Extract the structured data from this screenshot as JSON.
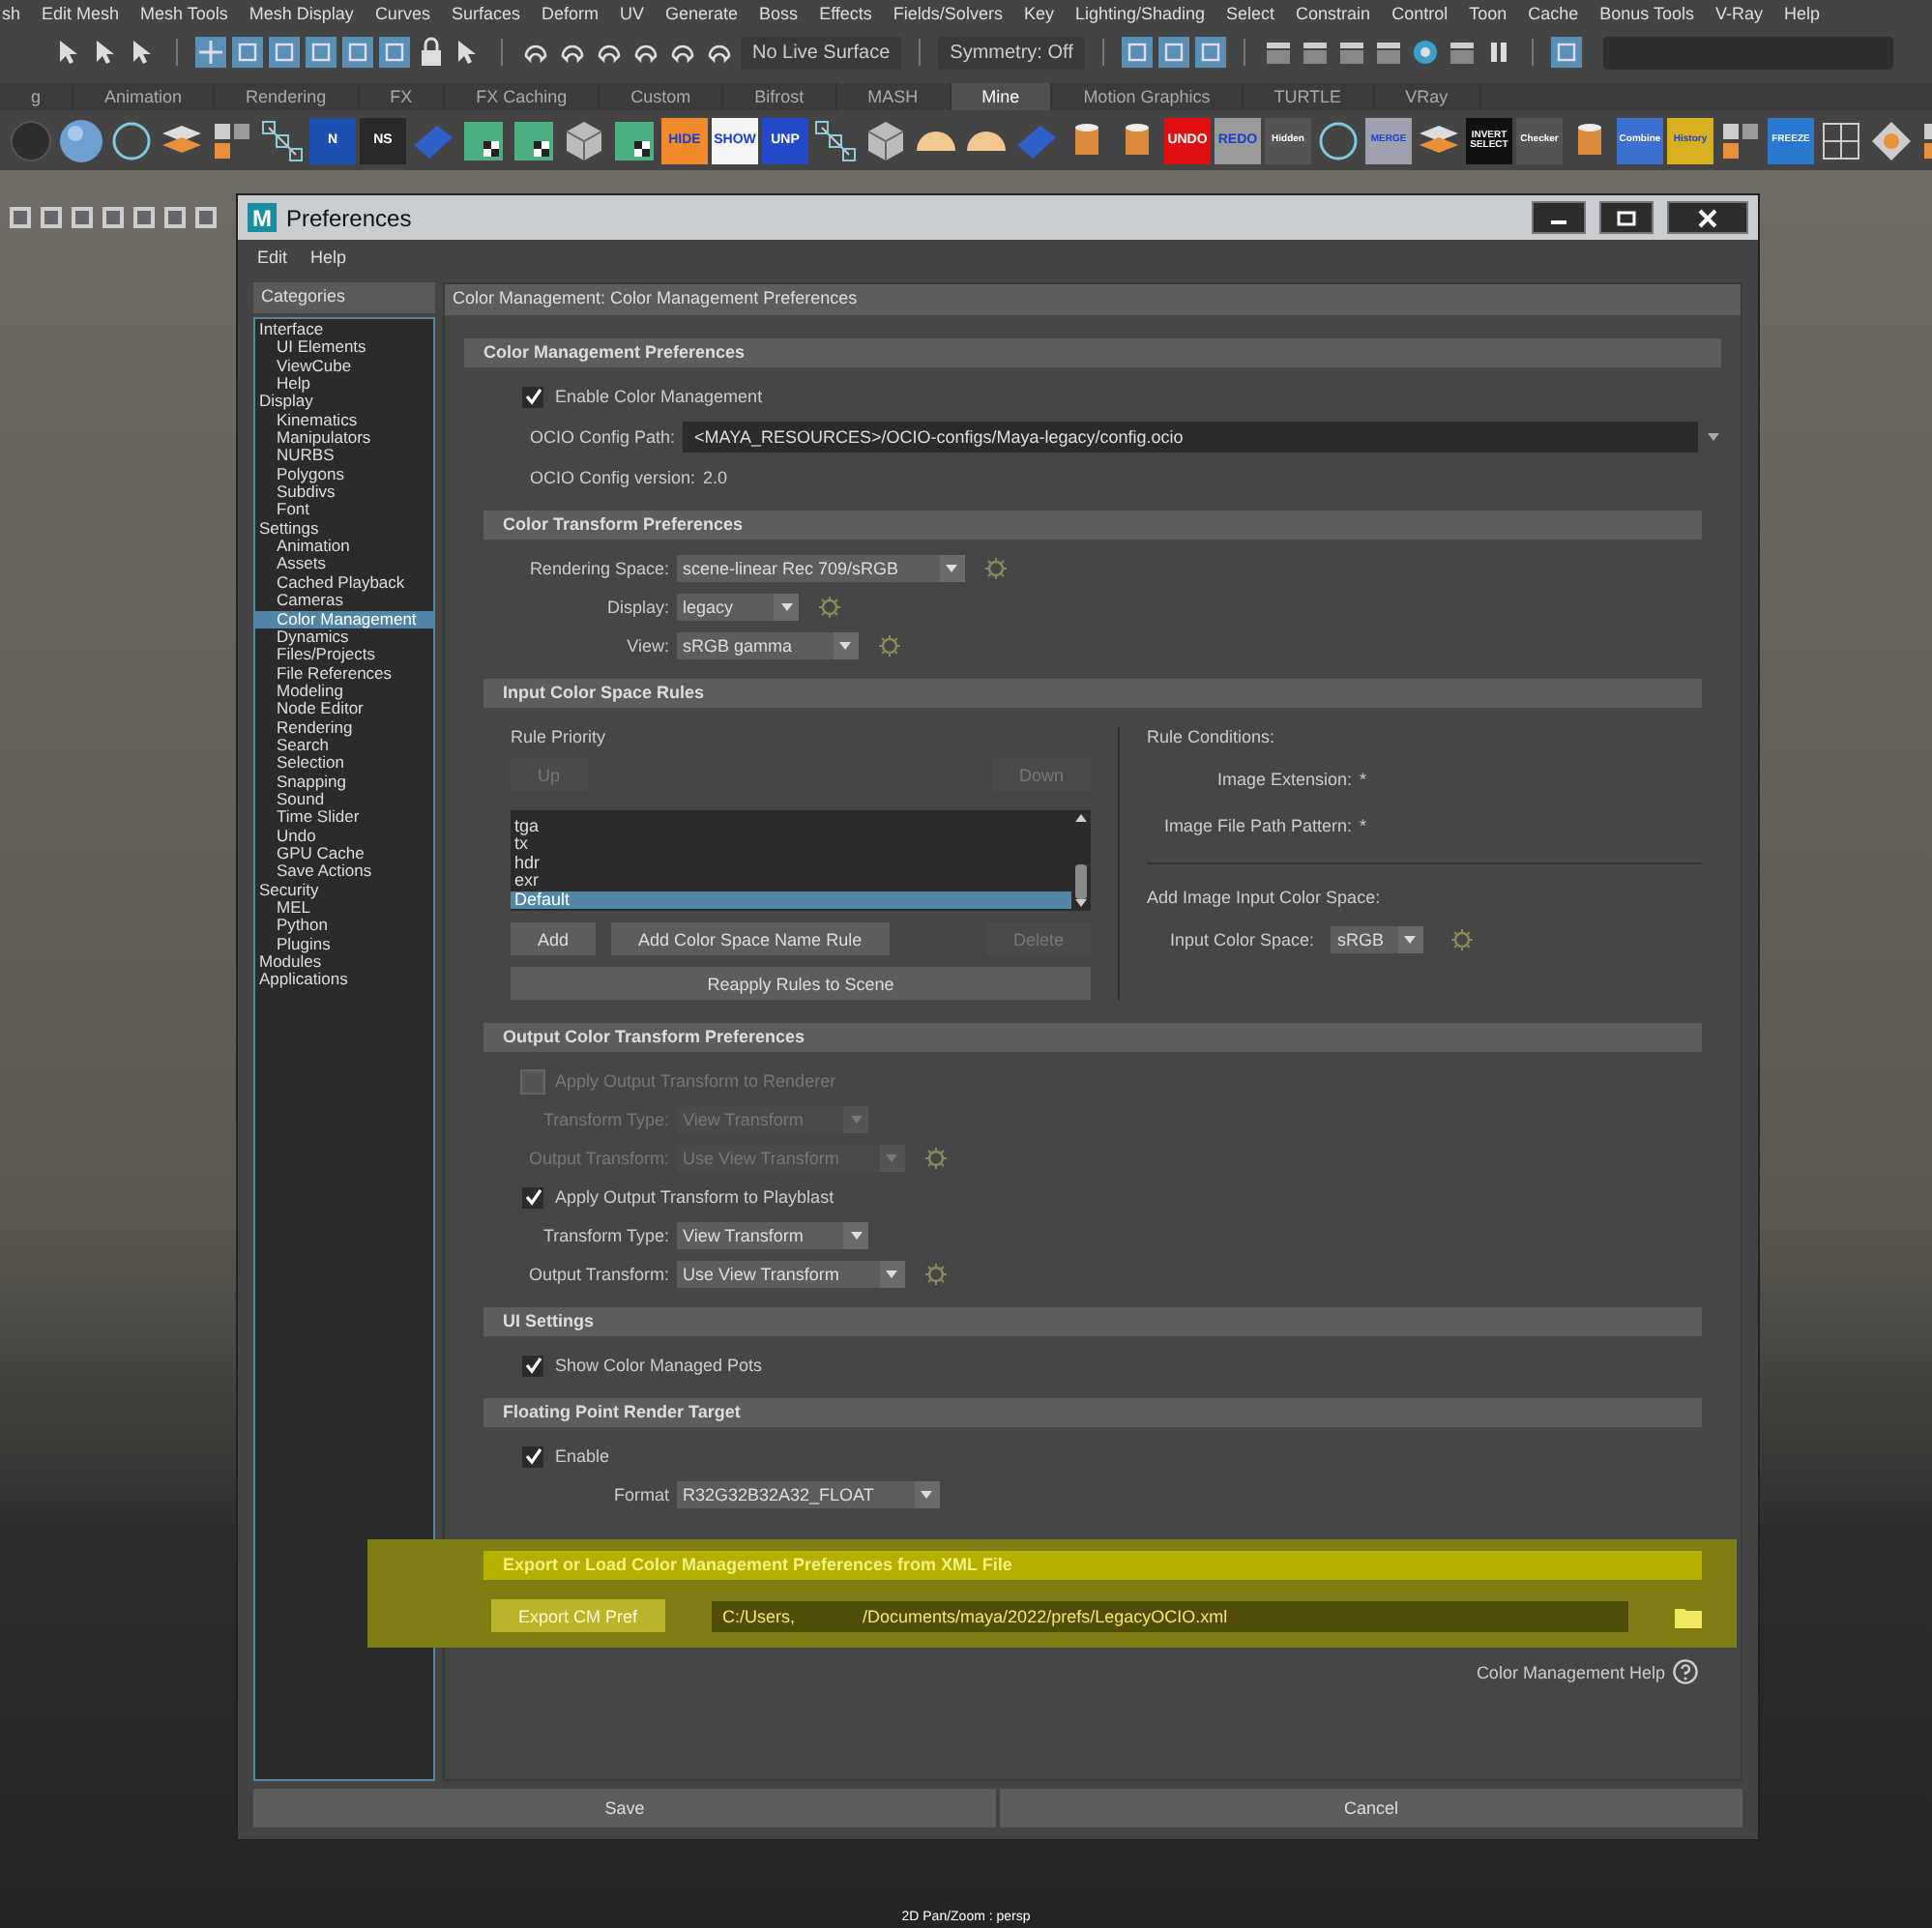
{
  "menu_bar": [
    "sh",
    "Edit Mesh",
    "Mesh Tools",
    "Mesh Display",
    "Curves",
    "Surfaces",
    "Deform",
    "UV",
    "Generate",
    "Boss",
    "Effects",
    "Fields/Solvers",
    "Key",
    "Lighting/Shading",
    "Select",
    "Constrain",
    "Control",
    "Toon",
    "Cache",
    "Bonus Tools",
    "V-Ray",
    "Help"
  ],
  "status_line": {
    "live_surface": "No Live Surface",
    "symmetry": "Symmetry: Off"
  },
  "shelf_tabs": [
    {
      "label": "g",
      "selected": false
    },
    {
      "label": "Animation",
      "selected": false
    },
    {
      "label": "Rendering",
      "selected": false
    },
    {
      "label": "FX",
      "selected": false
    },
    {
      "label": "FX Caching",
      "selected": false
    },
    {
      "label": "Custom",
      "selected": false
    },
    {
      "label": "Bifrost",
      "selected": false
    },
    {
      "label": "MASH",
      "selected": false
    },
    {
      "label": "Mine",
      "selected": true
    },
    {
      "label": "Motion Graphics",
      "selected": false
    },
    {
      "label": "TURTLE",
      "selected": false
    },
    {
      "label": "VRay",
      "selected": false
    }
  ],
  "shelf": [
    {
      "kind": "ball"
    },
    {
      "kind": "sphere"
    },
    {
      "kind": "ring"
    },
    {
      "kind": "layers"
    },
    {
      "kind": "blocks"
    },
    {
      "kind": "nodes"
    },
    {
      "kind": "tile",
      "label": "N",
      "color": "#1d4fb0"
    },
    {
      "kind": "tile",
      "label": "NS",
      "color": "#2a2a2a"
    },
    {
      "kind": "plane"
    },
    {
      "kind": "checker"
    },
    {
      "kind": "checker"
    },
    {
      "kind": "cube"
    },
    {
      "kind": "checker"
    },
    {
      "kind": "tile",
      "label": "HIDE",
      "color": "#f08a2a"
    },
    {
      "kind": "tile",
      "label": "SHOW",
      "color": "#f4f4f4"
    },
    {
      "kind": "tile",
      "label": "UNP",
      "color": "#2348c8"
    },
    {
      "kind": "nodes"
    },
    {
      "kind": "cube"
    },
    {
      "kind": "dome"
    },
    {
      "kind": "dome"
    },
    {
      "kind": "plane"
    },
    {
      "kind": "cylinder"
    },
    {
      "kind": "cylinder"
    },
    {
      "kind": "tile",
      "label": "UNDO",
      "color": "#e01010"
    },
    {
      "kind": "tile",
      "label": "REDO",
      "color": "#9a9a9a"
    },
    {
      "kind": "tile",
      "label": "Hidden",
      "color": "#555555"
    },
    {
      "kind": "ring"
    },
    {
      "kind": "tile",
      "label": "MERGE",
      "color": "#9ea2b0"
    },
    {
      "kind": "layers"
    },
    {
      "kind": "tile",
      "label": "INVERT SELECT",
      "color": "#111111"
    },
    {
      "kind": "tile",
      "label": "Checker",
      "color": "#555555"
    },
    {
      "kind": "cylinder"
    },
    {
      "kind": "tile",
      "label": "Combine",
      "color": "#3c6fd0"
    },
    {
      "kind": "tile",
      "label": "History",
      "color": "#d8b020"
    },
    {
      "kind": "blocks"
    },
    {
      "kind": "tile",
      "label": "FREEZE",
      "color": "#2a78d0"
    },
    {
      "kind": "grid"
    },
    {
      "kind": "diamond"
    },
    {
      "kind": "blocks"
    }
  ],
  "viewport": {
    "camera_label": "2D Pan/Zoom : persp"
  },
  "dialog": {
    "logo": "M",
    "title": "Preferences",
    "menu": [
      "Edit",
      "Help"
    ],
    "categories_title": "Categories",
    "categories": [
      {
        "label": "Interface",
        "selected": false,
        "children": [
          {
            "label": "UI Elements",
            "selected": false
          },
          {
            "label": "ViewCube",
            "selected": false
          },
          {
            "label": "Help",
            "selected": false
          }
        ]
      },
      {
        "label": "Display",
        "selected": false,
        "children": [
          {
            "label": "Kinematics",
            "selected": false
          },
          {
            "label": "Manipulators",
            "selected": false
          },
          {
            "label": "NURBS",
            "selected": false
          },
          {
            "label": "Polygons",
            "selected": false
          },
          {
            "label": "Subdivs",
            "selected": false
          },
          {
            "label": "Font",
            "selected": false
          }
        ]
      },
      {
        "label": "Settings",
        "selected": false,
        "children": [
          {
            "label": "Animation",
            "selected": false
          },
          {
            "label": "Assets",
            "selected": false
          },
          {
            "label": "Cached Playback",
            "selected": false
          },
          {
            "label": "Cameras",
            "selected": false
          },
          {
            "label": "Color Management",
            "selected": true
          },
          {
            "label": "Dynamics",
            "selected": false
          },
          {
            "label": "Files/Projects",
            "selected": false
          },
          {
            "label": "File References",
            "selected": false
          },
          {
            "label": "Modeling",
            "selected": false
          },
          {
            "label": "Node Editor",
            "selected": false
          },
          {
            "label": "Rendering",
            "selected": false
          },
          {
            "label": "Search",
            "selected": false
          },
          {
            "label": "Selection",
            "selected": false
          },
          {
            "label": "Snapping",
            "selected": false
          },
          {
            "label": "Sound",
            "selected": false
          },
          {
            "label": "Time Slider",
            "selected": false
          },
          {
            "label": "Undo",
            "selected": false
          },
          {
            "label": "GPU Cache",
            "selected": false
          },
          {
            "label": "Save Actions",
            "selected": false
          }
        ]
      },
      {
        "label": "Security",
        "selected": false,
        "children": [
          {
            "label": "MEL",
            "selected": false
          },
          {
            "label": "Python",
            "selected": false
          },
          {
            "label": "Plugins",
            "selected": false
          }
        ]
      },
      {
        "label": "Modules",
        "selected": false
      },
      {
        "label": "Applications",
        "selected": false
      }
    ],
    "panel_title": "Color Management: Color Management Preferences",
    "group": {
      "title": "Color Management Preferences",
      "rows": [
        {
          "kind": "checkbox",
          "label": "Enable Color Management",
          "checked": true,
          "disabled": false
        },
        {
          "kind": "path",
          "label": "OCIO Config Path:",
          "value": "<MAYA_RESOURCES>/OCIO-configs/Maya-legacy/config.ocio"
        },
        {
          "kind": "info",
          "label": "OCIO Config version:",
          "value": "2.0"
        }
      ],
      "sections": [
        {
          "kind": "rows",
          "title": "Color Transform Preferences",
          "rows": [
            {
              "kind": "dropdown",
              "label": "Rendering Space:",
              "value": "scene-linear Rec 709/sRGB",
              "disabled": false,
              "gear": true
            },
            {
              "kind": "dropdown",
              "label": "Display:",
              "value": "legacy",
              "disabled": false,
              "gear": true
            },
            {
              "kind": "dropdown",
              "label": "View:",
              "value": "sRGB gamma",
              "disabled": false,
              "gear": true
            }
          ]
        },
        {
          "kind": "rules",
          "title": "Input Color Space Rules",
          "priority_label": "Rule Priority",
          "up": {
            "label": "Up",
            "disabled": true
          },
          "down": {
            "label": "Down",
            "disabled": true
          },
          "rules": [
            {
              "label": "tga",
              "selected": false
            },
            {
              "label": "tx",
              "selected": false
            },
            {
              "label": "hdr",
              "selected": false
            },
            {
              "label": "exr",
              "selected": false
            },
            {
              "label": "Default",
              "selected": true
            }
          ],
          "add": {
            "label": "Add",
            "disabled": false
          },
          "add_name_rule": {
            "label": "Add Color Space Name Rule",
            "disabled": false
          },
          "delete": {
            "label": "Delete",
            "disabled": true
          },
          "reapply": {
            "label": "Reapply Rules to Scene",
            "disabled": false
          },
          "conditions_label": "Rule Conditions:",
          "conditions": [
            {
              "label": "Image Extension:",
              "value": "*"
            },
            {
              "label": "Image File Path Pattern:",
              "value": "*"
            }
          ],
          "add_input_label": "Add Image Input Color Space:",
          "input_label": "Input Color Space:",
          "input_value": "sRGB"
        },
        {
          "kind": "rows",
          "title": "Output Color Transform Preferences",
          "rows": [
            {
              "kind": "checkbox",
              "label": "Apply Output Transform to Renderer",
              "checked": false,
              "disabled": true
            },
            {
              "kind": "dropdown",
              "label": "Transform Type:",
              "value": "View Transform",
              "disabled": true,
              "gear": false
            },
            {
              "kind": "dropdown",
              "label": "Output Transform:",
              "value": "Use View Transform",
              "disabled": true,
              "gear": true
            },
            {
              "kind": "checkbox",
              "label": "Apply Output Transform to Playblast",
              "checked": true,
              "disabled": false
            },
            {
              "kind": "dropdown",
              "label": "Transform Type:",
              "value": "View Transform",
              "disabled": false,
              "gear": false
            },
            {
              "kind": "dropdown",
              "label": "Output Transform:",
              "value": "Use View Transform",
              "disabled": false,
              "gear": true
            }
          ]
        },
        {
          "kind": "rows",
          "title": "UI Settings",
          "rows": [
            {
              "kind": "checkbox",
              "label": "Show Color Managed Pots",
              "checked": true,
              "disabled": false
            }
          ]
        },
        {
          "kind": "rows",
          "title": "Floating Point Render Target",
          "rows": [
            {
              "kind": "checkbox",
              "label": "Enable",
              "checked": true,
              "disabled": false
            },
            {
              "kind": "dropdown",
              "label": "Format",
              "value": "R32G32B32A32_FLOAT",
              "disabled": false,
              "gear": false
            }
          ]
        },
        {
          "kind": "export",
          "title": "Export or Load Color Management Preferences from XML File",
          "highlighted": true,
          "button": "Export CM Pref",
          "path": "C:/Users,              /Documents/maya/2022/prefs/LegacyOCIO.xml"
        }
      ]
    },
    "help_link": "Color Management Help",
    "buttons": [
      "Save",
      "Cancel"
    ]
  }
}
